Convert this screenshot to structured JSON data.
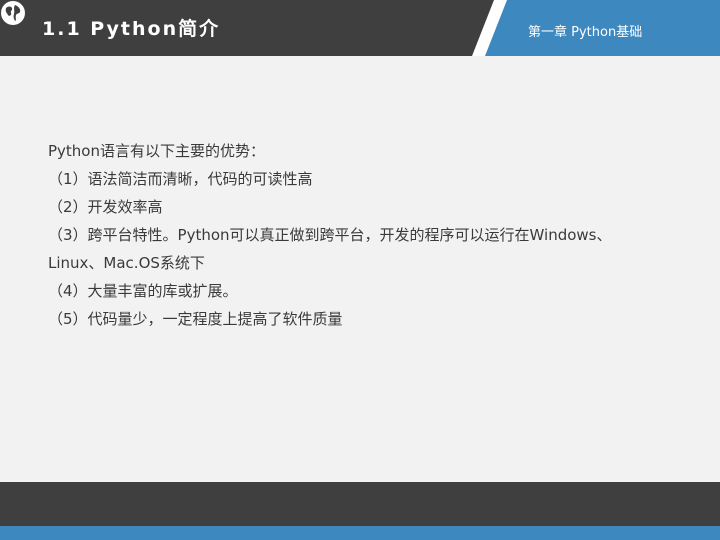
{
  "header": {
    "title": "1.1 Python简介",
    "chapter": "第一章 Python基础",
    "colors": {
      "dark": "#3f3f3f",
      "accent": "#3d88be"
    },
    "logo_icon": "globe-icon"
  },
  "content": {
    "lines": [
      "Python语言有以下主要的优势：",
      "（1）语法简洁而清晰，代码的可读性高",
      "（2）开发效率高",
      "（3）跨平台特性。Python可以真正做到跨平台，开发的程序可以运行在Windows、",
      "Linux、Mac.OS系统下",
      "（4）大量丰富的库或扩展。",
      "（5）代码量少，一定程度上提高了软件质量"
    ]
  }
}
